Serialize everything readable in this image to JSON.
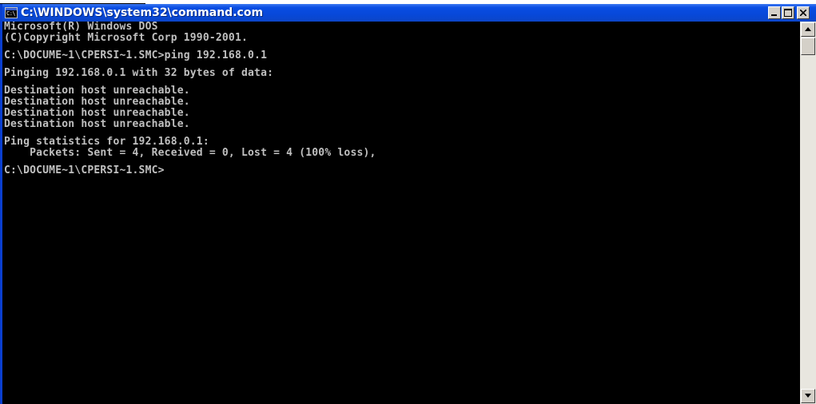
{
  "window": {
    "title": "C:\\WINDOWS\\system32\\command.com",
    "icon": "console-icon",
    "icon_text": "C:\\"
  },
  "controls": {
    "minimize_icon": "minimize-icon",
    "maximize_icon": "maximize-icon",
    "close_icon": "close-icon"
  },
  "console": {
    "text_color": "#c0c0c0",
    "background": "#000000",
    "lines": [
      "Microsoft(R) Windows DOS",
      "(C)Copyright Microsoft Corp 1990-2001.",
      "",
      "C:\\DOCUME~1\\CPERSI~1.SMC>ping 192.168.0.1",
      "",
      "Pinging 192.168.0.1 with 32 bytes of data:",
      "",
      "Destination host unreachable.",
      "Destination host unreachable.",
      "Destination host unreachable.",
      "Destination host unreachable.",
      "",
      "Ping statistics for 192.168.0.1:",
      "    Packets: Sent = 4, Received = 0, Lost = 4 (100% loss),",
      "",
      "C:\\DOCUME~1\\CPERSI~1.SMC>"
    ]
  },
  "scrollbar": {
    "up_icon": "arrow-up-icon",
    "down_icon": "arrow-down-icon"
  },
  "colors": {
    "titlebar": "#0a4ee3",
    "window_frame": "#d4d0c8"
  }
}
